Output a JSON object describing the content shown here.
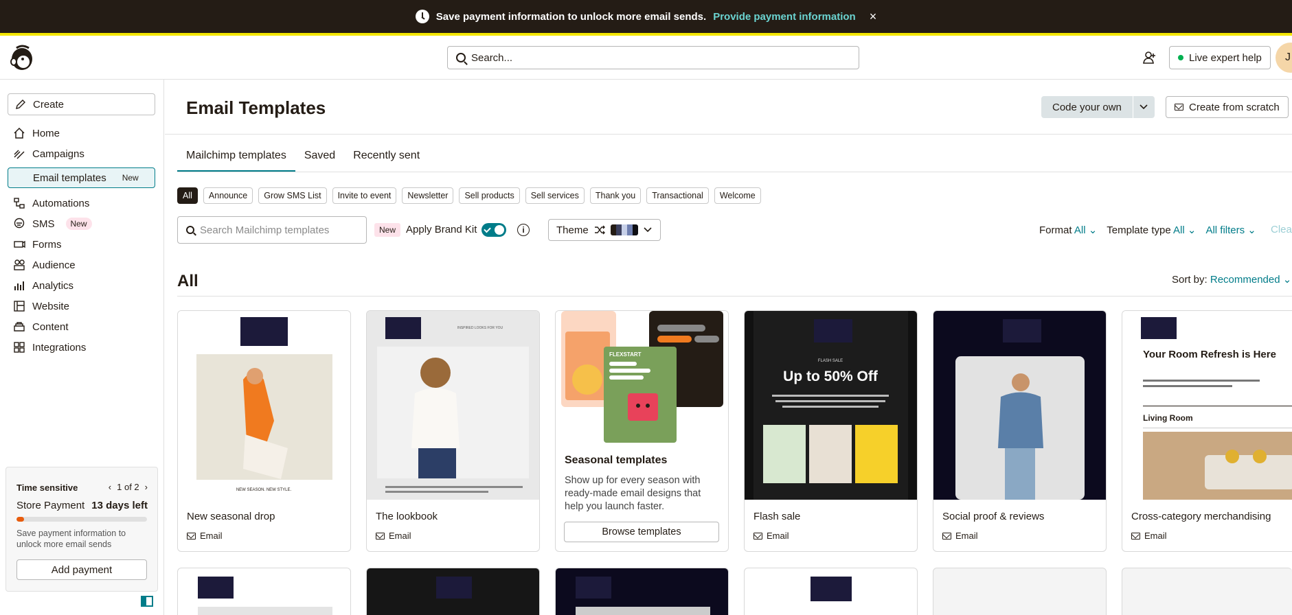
{
  "banner": {
    "message": "Save payment information to unlock more email sends.",
    "link": "Provide payment information",
    "close": "×"
  },
  "header": {
    "search_placeholder": "Search...",
    "live_help": "Live expert help",
    "avatar_initial": "J"
  },
  "sidebar": {
    "create": "Create",
    "items": [
      {
        "label": "Home",
        "icon": "home-icon"
      },
      {
        "label": "Campaigns",
        "icon": "campaigns-icon"
      },
      {
        "label": "Email templates",
        "badge": "New"
      },
      {
        "label": "Automations",
        "icon": "automations-icon"
      },
      {
        "label": "SMS",
        "badge": "New",
        "icon": "sms-icon"
      },
      {
        "label": "Forms",
        "icon": "forms-icon"
      },
      {
        "label": "Audience",
        "icon": "audience-icon"
      },
      {
        "label": "Analytics",
        "icon": "analytics-icon"
      },
      {
        "label": "Website",
        "icon": "website-icon"
      },
      {
        "label": "Content",
        "icon": "content-icon"
      },
      {
        "label": "Integrations",
        "icon": "integrations-icon"
      }
    ],
    "notice": {
      "title": "Time sensitive",
      "pager": "1 of 2",
      "item": "Store Payment",
      "days": "13 days left",
      "progress": 0.06,
      "desc": "Save payment information to unlock more email sends",
      "button": "Add payment"
    }
  },
  "main": {
    "title": "Email Templates",
    "code_own": "Code your own",
    "create_scratch": "Create from scratch",
    "tabs": [
      "Mailchimp templates",
      "Saved",
      "Recently sent"
    ],
    "chips": [
      "All",
      "Announce",
      "Grow SMS List",
      "Invite to event",
      "Newsletter",
      "Sell products",
      "Sell services",
      "Thank you",
      "Transactional",
      "Welcome"
    ],
    "search_placeholder": "Search Mailchimp templates",
    "new_pill": "New",
    "apply_brand_kit": "Apply Brand Kit",
    "theme_label": "Theme",
    "format_label": "Format",
    "format_value": "All",
    "type_label": "Template type",
    "type_value": "All",
    "all_filters": "All filters",
    "clear": "Clear",
    "section_title": "All",
    "sort_label": "Sort by:",
    "sort_value": "Recommended",
    "cards": [
      {
        "name": "New seasonal drop",
        "type": "Email"
      },
      {
        "name": "The lookbook",
        "type": "Email"
      },
      {
        "name": "Seasonal templates",
        "desc": "Show up for every season with ready-made email designs that help you launch faster.",
        "button": "Browse templates"
      },
      {
        "name": "Flash sale",
        "type": "Email",
        "headline": "Up to 50% Off",
        "kicker": "FLASH SALE"
      },
      {
        "name": "Social proof & reviews",
        "type": "Email"
      },
      {
        "name": "Cross-category merchandising",
        "type": "Email",
        "headline": "Your Room Refresh is Here",
        "sub": "Living Room"
      }
    ],
    "thumb_texts": {
      "seasonal": "NEW SEASON. NEW STYLE.",
      "lookbook": "INSPIRED LOOKS FOR YOU",
      "flexstart": "FLEXSTART"
    }
  },
  "colors": {
    "accent": "#007c89",
    "banner_bg": "#241c15",
    "banner_border": "#f3e600",
    "link": "#6bd4d1"
  }
}
